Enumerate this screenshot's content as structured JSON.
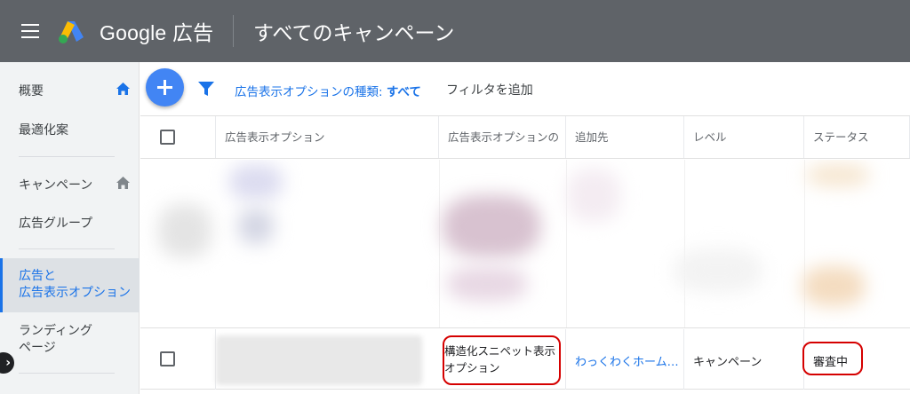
{
  "header": {
    "brand": "Google 広告",
    "page_title": "すべてのキャンペーン"
  },
  "sidebar": {
    "items": [
      {
        "label": "概要",
        "icon": "home-icon"
      },
      {
        "label": "最適化案"
      },
      {
        "label": "キャンペーン",
        "icon": "home-icon"
      },
      {
        "label": "広告グループ"
      },
      {
        "label_line1": "広告と",
        "label_line2": "広告表示オプション"
      },
      {
        "label_line1": "ランディング",
        "label_line2": "ページ"
      }
    ]
  },
  "toolbar": {
    "filter_label": "広告表示オプションの種類: ",
    "filter_value": "すべて",
    "add_filter": "フィルタを追加"
  },
  "table": {
    "columns": [
      "広告表示オプション",
      "広告表示オプションの",
      "追加先",
      "レベル",
      "ステータス"
    ],
    "row": {
      "type": "構造化スニペット表示オプション",
      "added_to": "わっくわくホーム…",
      "level": "キャンペーン",
      "status": "審査中"
    }
  },
  "colors": {
    "topbar": "#5f6368",
    "accent": "#1a73e8",
    "highlight": "#d50000"
  }
}
